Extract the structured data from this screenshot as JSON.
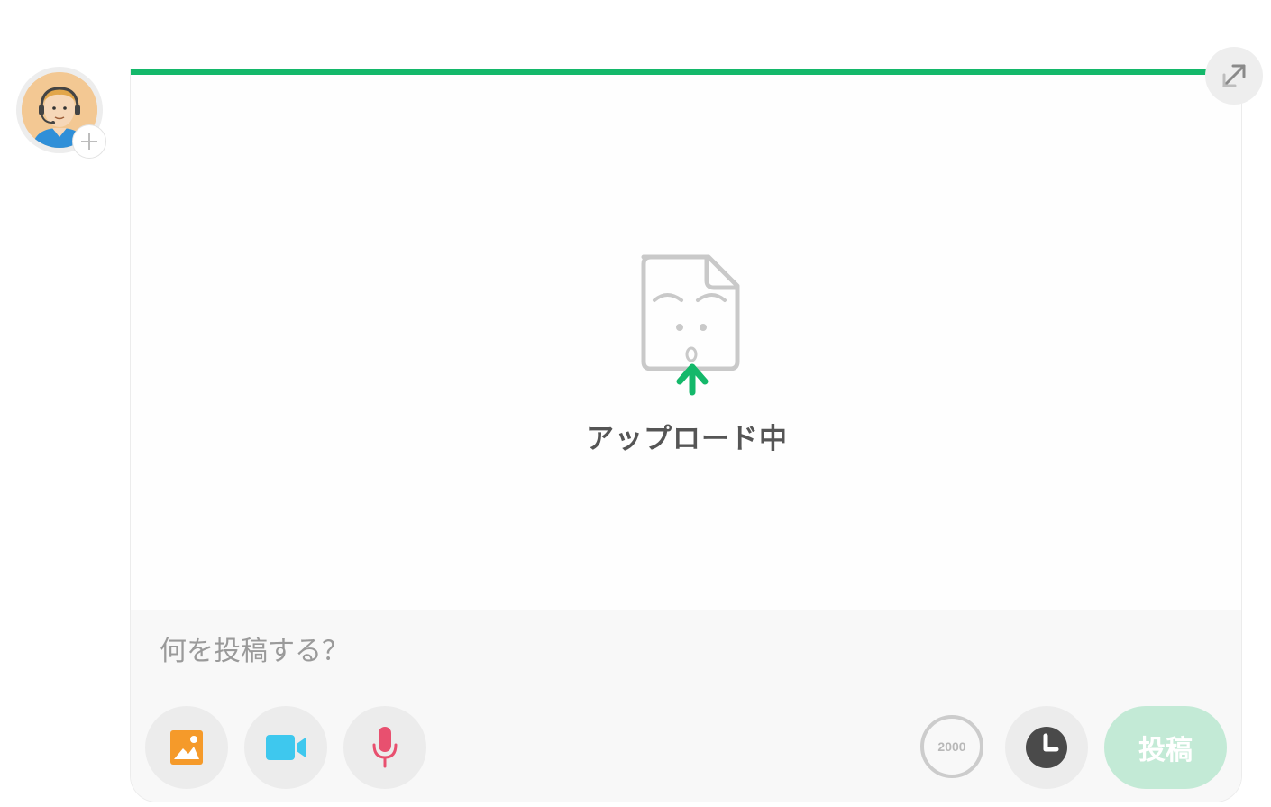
{
  "upload": {
    "status_label": "アップロード中",
    "progress": 1.0
  },
  "composer": {
    "placeholder": "何を投稿する？",
    "char_limit": "2000",
    "submit_label": "投稿"
  },
  "toolbar": {
    "image_icon": "image-icon",
    "video_icon": "video-camera-icon",
    "audio_icon": "microphone-icon",
    "schedule_icon": "clock-icon"
  },
  "colors": {
    "accent": "#14b86a",
    "submit_disabled": "#c3ead6",
    "image_icon": "#f59a2a",
    "video_icon": "#3ec8ee",
    "mic_icon": "#e8506f"
  }
}
